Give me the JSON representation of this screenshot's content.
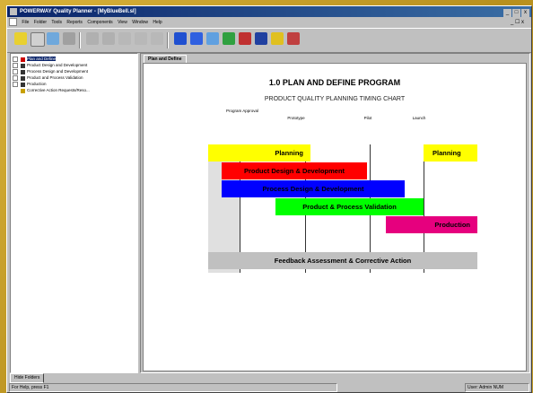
{
  "window": {
    "title": "POWERWAY Quality Planner - [MyBlueBell.sl]",
    "controls": [
      "_",
      "□",
      "x"
    ]
  },
  "menu": {
    "items": [
      "File",
      "Folder",
      "Tools",
      "Reports",
      "Components",
      "View",
      "Window",
      "Help"
    ],
    "mdi_controls": "_ ☐ x"
  },
  "tree": {
    "items": [
      {
        "label": "Plan and Define",
        "icon_color": "#cc0000",
        "selected": true
      },
      {
        "label": "Product Design and Development",
        "icon_color": "#333333",
        "selected": false
      },
      {
        "label": "Process Design and Development",
        "icon_color": "#333333",
        "selected": false
      },
      {
        "label": "Product and Process Validation",
        "icon_color": "#333333",
        "selected": false
      },
      {
        "label": "Production",
        "icon_color": "#333333",
        "selected": false
      },
      {
        "label": "Corrective Action Requests/Reso...",
        "icon_color": "#c8a000",
        "selected": false
      }
    ]
  },
  "document": {
    "tab_label": "Plan and Define",
    "title": "1.0 PLAN AND DEFINE PROGRAM",
    "subtitle": "PRODUCT QUALITY PLANNING TIMING CHART",
    "milestones": [
      "Program Approval",
      "Prototype",
      "Pilot",
      "Launch"
    ]
  },
  "chart_data": {
    "type": "table",
    "title": "1.0 PLAN AND DEFINE PROGRAM",
    "subtitle": "PRODUCT QUALITY PLANNING TIMING CHART",
    "milestones": [
      "Program Approval",
      "Prototype",
      "Pilot",
      "Launch"
    ],
    "phases": [
      {
        "name": "Planning",
        "color": "#ffff00",
        "start": 0.0,
        "end": 0.38
      },
      {
        "name": "Planning",
        "color": "#ffff00",
        "start": 0.8,
        "end": 1.0
      },
      {
        "name": "Product Design & Development",
        "color": "#ff0000",
        "start": 0.05,
        "end": 0.59
      },
      {
        "name": "Process Design & Development",
        "color": "#0000ff",
        "start": 0.05,
        "end": 0.73
      },
      {
        "name": "Product & Process Validation",
        "color": "#00ff00",
        "start": 0.25,
        "end": 0.8
      },
      {
        "name": "Production",
        "color": "#e6007e",
        "start": 0.66,
        "end": 1.0
      },
      {
        "name": "Feedback Assessment & Corrective Action",
        "color": "#c0c0c0",
        "start": 0.0,
        "end": 1.0
      }
    ]
  },
  "bottom_tab": {
    "label": "Hide Folders"
  },
  "status": {
    "left": "For Help, press F1",
    "right": "User: Admin  NUM"
  }
}
